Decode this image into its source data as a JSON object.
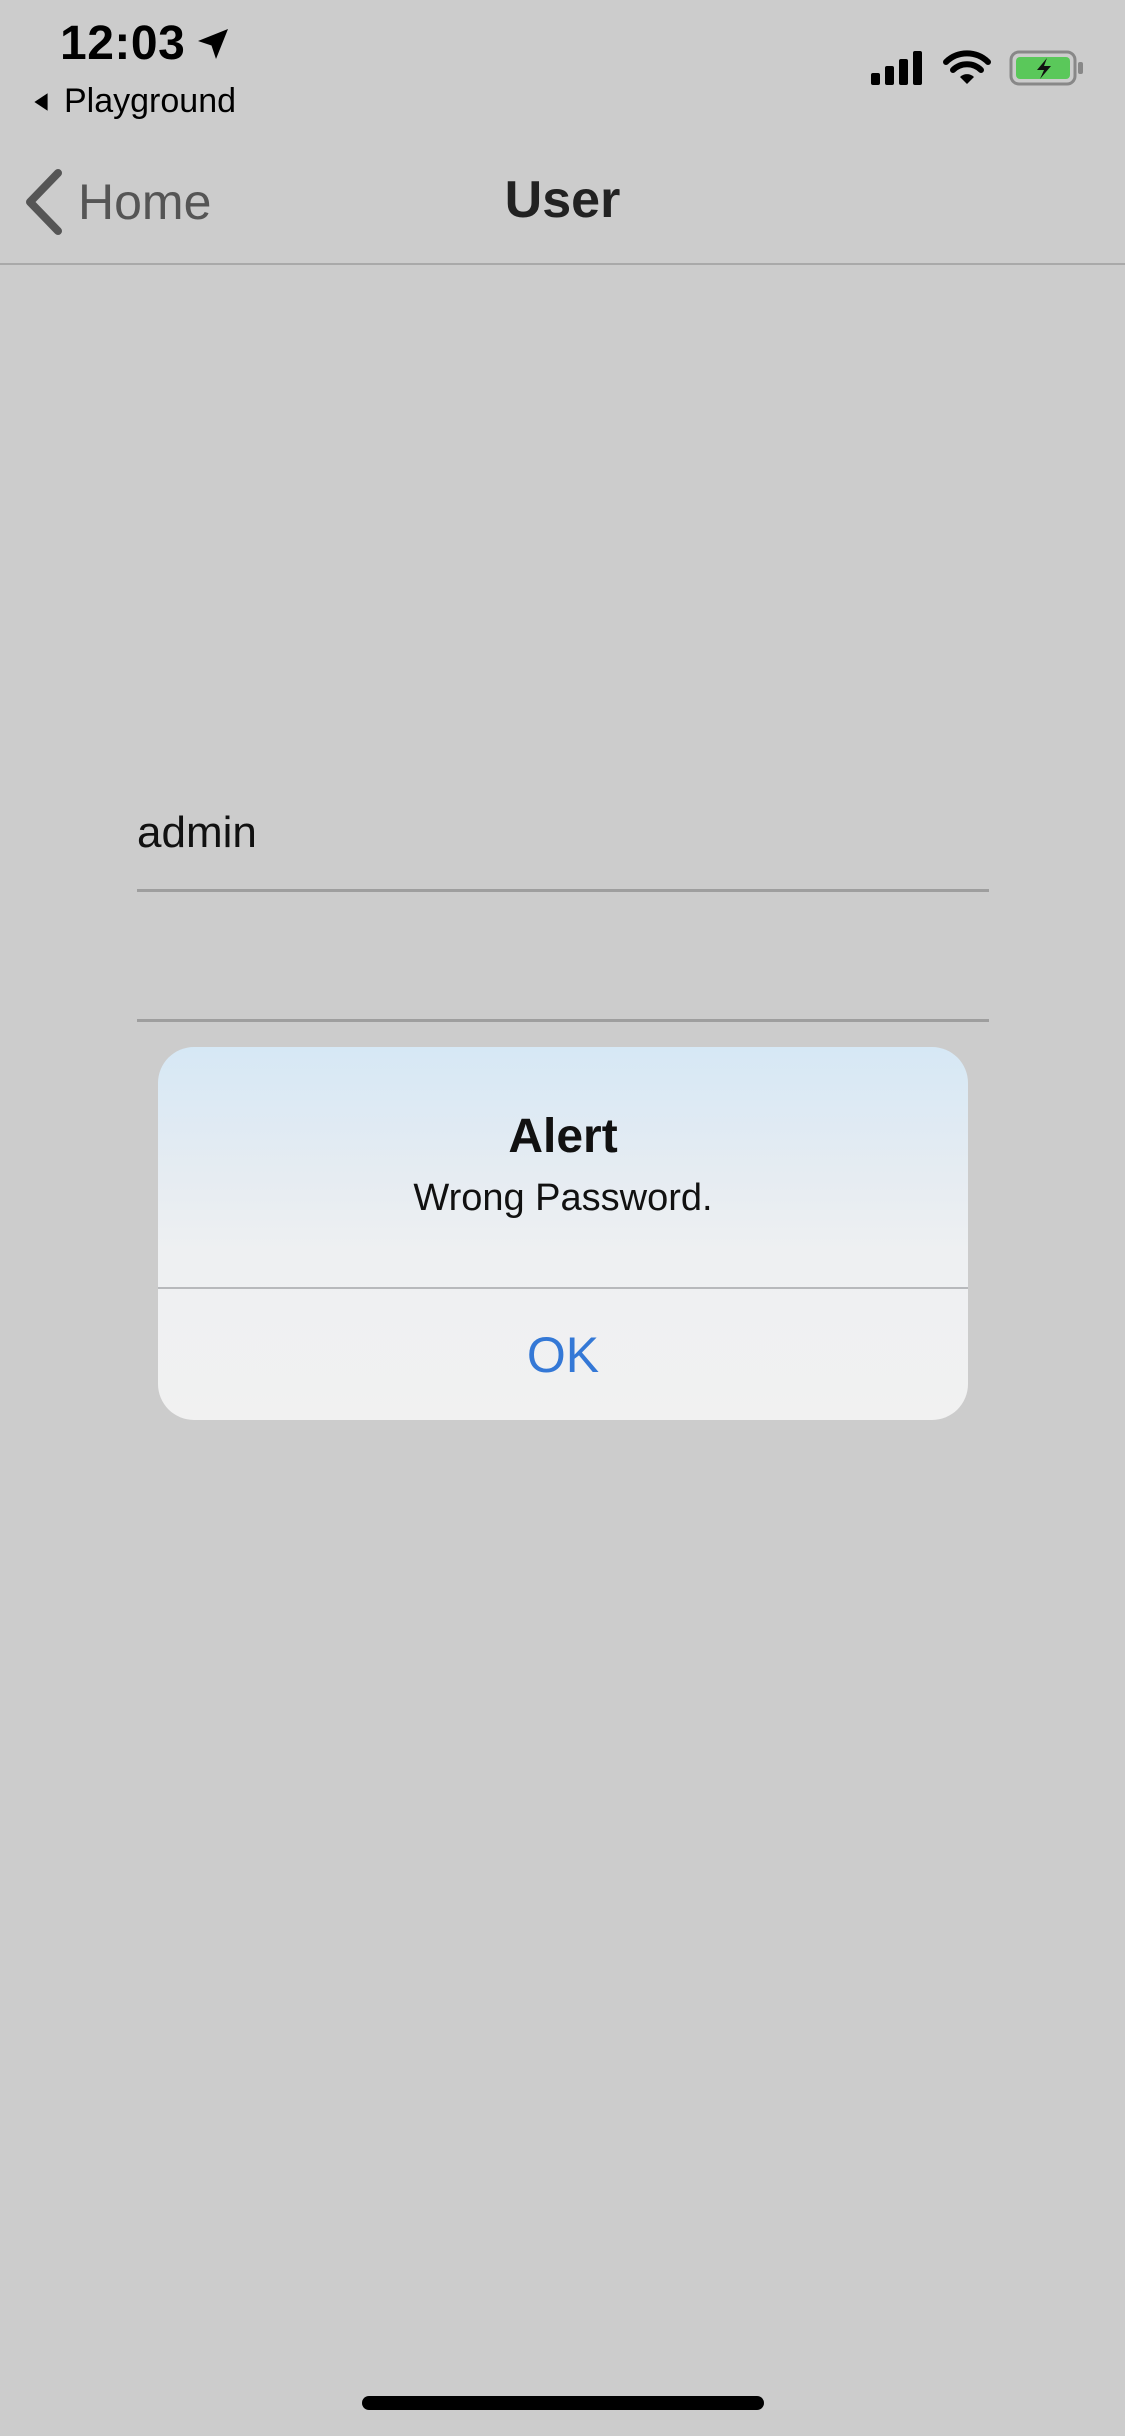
{
  "status_bar": {
    "time": "12:03",
    "back_to_app": "Playground",
    "icons": [
      "location-arrow-icon",
      "cellular-signal-icon",
      "wifi-icon",
      "battery-charging-icon"
    ],
    "battery_color": "#5ac85a"
  },
  "navbar": {
    "back_label": "Home",
    "title": "User"
  },
  "form": {
    "username_value": "admin",
    "password_value": ""
  },
  "alert": {
    "title": "Alert",
    "message": "Wrong Password.",
    "ok_label": "OK",
    "ok_color": "#3478d6"
  }
}
